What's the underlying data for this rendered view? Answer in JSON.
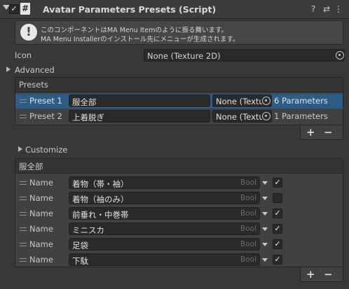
{
  "header": {
    "icon_glyph": "#",
    "title": "Avatar Parameters Presets (Script)",
    "help_glyph": "?",
    "settings_glyph": "⇄",
    "menu_glyph": "⋮"
  },
  "helpbox": {
    "icon_glyph": "!",
    "line1": "このコンポーネントはMA Menu Itemのように振る舞います。",
    "line2": "MA Menu Installerのインストール先にメニューが生成されます。"
  },
  "icon_field": {
    "label": "Icon",
    "value": "None (Texture 2D)"
  },
  "advanced": {
    "label": "Advanced"
  },
  "presets": {
    "header": "Presets",
    "rows": [
      {
        "label": "Preset 1",
        "name": "服全部",
        "texture": "None (Texture",
        "count": "6 Parameters",
        "selected": true
      },
      {
        "label": "Preset 2",
        "name": "上着脱ぎ",
        "texture": "None (Texture",
        "count": "1 Parameters",
        "selected": false
      }
    ],
    "add": "+",
    "remove": "−"
  },
  "customize": {
    "label": "Customize"
  },
  "params": {
    "header": "服全部",
    "rows": [
      {
        "label": "Name",
        "value": "着物（帯・袖）",
        "type": "Bool",
        "checked": true
      },
      {
        "label": "Name",
        "value": "着物（袖のみ）",
        "type": "Bool",
        "checked": false
      },
      {
        "label": "Name",
        "value": "前垂れ・中巻帯",
        "type": "Bool",
        "checked": true
      },
      {
        "label": "Name",
        "value": "ミニスカ",
        "type": "Bool",
        "checked": true
      },
      {
        "label": "Name",
        "value": "足袋",
        "type": "Bool",
        "checked": true
      },
      {
        "label": "Name",
        "value": "下駄",
        "type": "Bool",
        "checked": true
      }
    ],
    "add": "+",
    "remove": "−"
  }
}
